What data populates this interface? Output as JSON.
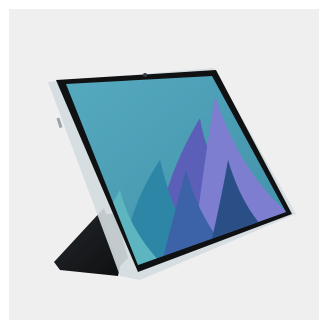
{
  "scene": {
    "subject": "tablet-in-folio-case",
    "background_color": "#efeff0",
    "case_color": "#17191b",
    "bumper_color": "#cfd8dc",
    "bezel_color": "#0f1113",
    "wallpaper": {
      "sky_color": "#4fa3b8",
      "wave_colors": [
        "#5c5fb8",
        "#3c63a8",
        "#2e86a6",
        "#5db6bf",
        "#2a4f86",
        "#7e7ed0"
      ]
    }
  }
}
